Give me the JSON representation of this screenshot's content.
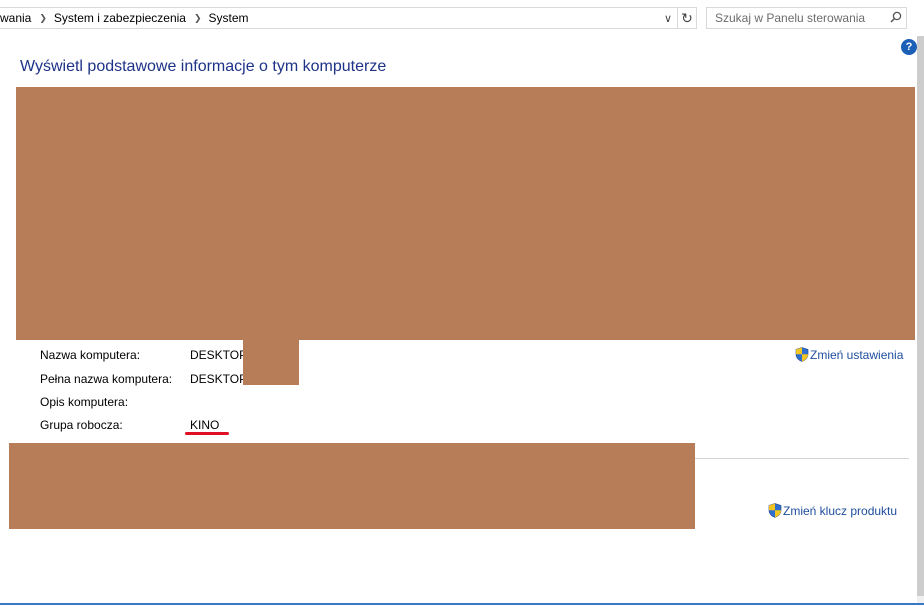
{
  "breadcrumb": {
    "items": [
      "wania",
      "System i zabezpieczenia",
      "System"
    ]
  },
  "search": {
    "placeholder": "Szukaj w Panelu sterowania"
  },
  "help": {
    "label": "?"
  },
  "page": {
    "title": "Wyświetl podstawowe informacje o tym komputerze"
  },
  "computer": {
    "name_label": "Nazwa komputera:",
    "name_value": "DESKTOP-",
    "full_name_label": "Pełna nazwa komputera:",
    "full_name_value": "DESKTOP-",
    "description_label": "Opis komputera:",
    "workgroup_label": "Grupa robocza:",
    "workgroup_value": "KINO"
  },
  "links": {
    "change_settings": "Zmień ustawienia",
    "change_product_key": "Zmień klucz produktu"
  },
  "icons": {
    "breadcrumb_separator": "chevron-right-icon",
    "dropdown": "chevron-down-icon",
    "refresh": "refresh-icon",
    "search": "search-icon",
    "shield": "uac-shield-icon",
    "help": "help-icon"
  },
  "colors": {
    "title": "#1e3287",
    "link": "#1e4d9c",
    "redaction": "#b77c58",
    "underline": "#e00e22",
    "help": "#1c5fb7"
  }
}
